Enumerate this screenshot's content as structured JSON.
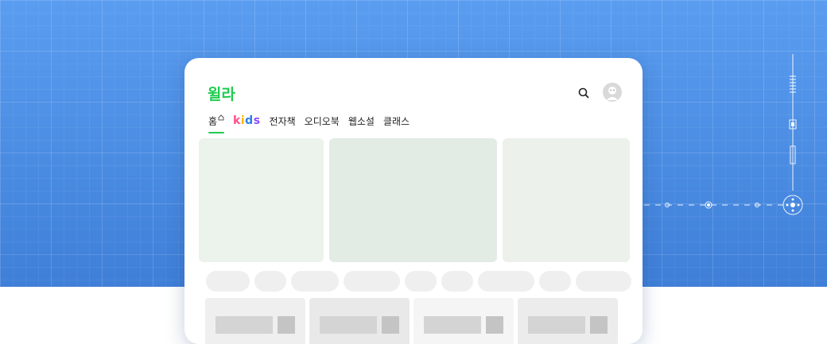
{
  "app": {
    "logo_text": "윌라",
    "brand_color": "#1fcc4f",
    "background_color": "#4a8de6"
  },
  "header": {
    "search_icon": "search-icon",
    "avatar_icon": "avatar"
  },
  "nav": {
    "items": [
      {
        "label": "홈",
        "active": true
      },
      {
        "label": "kids",
        "active": false
      },
      {
        "label": "전자책",
        "active": false
      },
      {
        "label": "오디오북",
        "active": false
      },
      {
        "label": "웹소설",
        "active": false
      },
      {
        "label": "클래스",
        "active": false
      }
    ]
  },
  "banners": [
    {
      "color": "#ecf2ec"
    },
    {
      "color": "#e2ece4"
    },
    {
      "color": "#ecf1ec"
    }
  ],
  "chips_count": 9,
  "cards": [
    {
      "color": "#efefef"
    },
    {
      "color": "#e9e9e9"
    },
    {
      "color": "#f5f5f5"
    },
    {
      "color": "#ececec"
    }
  ]
}
